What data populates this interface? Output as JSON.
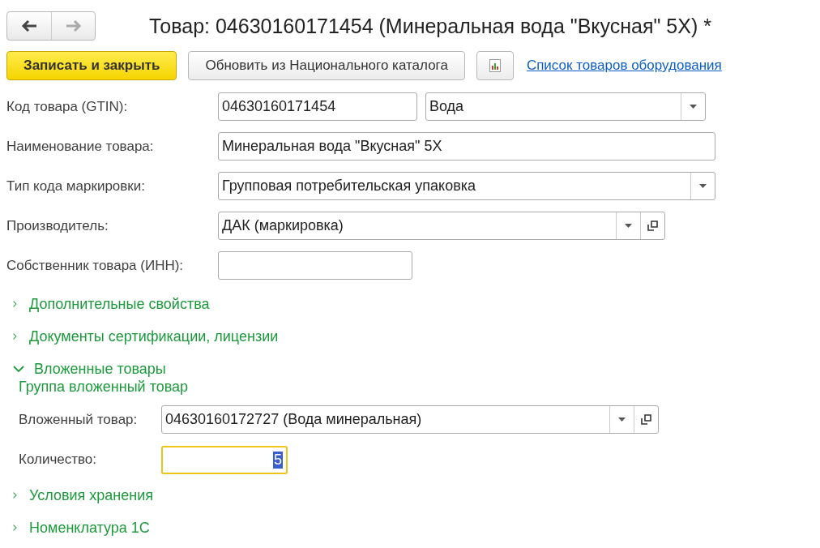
{
  "nav": [
    {
      "kind": "back",
      "disabled": false
    },
    {
      "kind": "forward",
      "disabled": true
    }
  ],
  "window": {
    "title": "Товар: 04630160171454 (Минеральная вода \"Вкусная\" 5X) *"
  },
  "toolbar": {
    "primary": "Записать и закрыть",
    "update": "Обновить из Национального каталога",
    "link": "Список товаров оборудования"
  },
  "fields": [
    {
      "label": "Код товара (GTIN):",
      "kind": "text",
      "value": "04630160171454",
      "extra": {
        "kind": "select",
        "value": "Вода"
      }
    },
    {
      "label": "Наименование товара:",
      "kind": "text",
      "value": "Минеральная вода \"Вкусная\" 5X"
    },
    {
      "label": "Тип кода маркировки:",
      "kind": "select",
      "value": "Групповая потребительская упаковка"
    },
    {
      "label": "Производитель:",
      "kind": "select_open",
      "value": "ДАК (маркировка)"
    },
    {
      "label": "Собственник товара (ИНН):",
      "kind": "text"
    }
  ],
  "sections": [
    {
      "label": "Дополнительные свойства",
      "expanded": false
    },
    {
      "label": "Документы сертификации, лицензии",
      "expanded": false
    },
    {
      "label": "Вложенные товары",
      "expanded": true,
      "group": "Группа вложенный товар",
      "fields": [
        {
          "label": "Вложенный товар:",
          "kind": "select_open",
          "value": "04630160172727 (Вода минеральная)"
        },
        {
          "label": "Количество:",
          "kind": "number",
          "value": "5",
          "focused": true
        }
      ]
    },
    {
      "label": "Условия хранения",
      "expanded": false
    },
    {
      "label": "Номенклатура 1С",
      "expanded": false
    }
  ]
}
